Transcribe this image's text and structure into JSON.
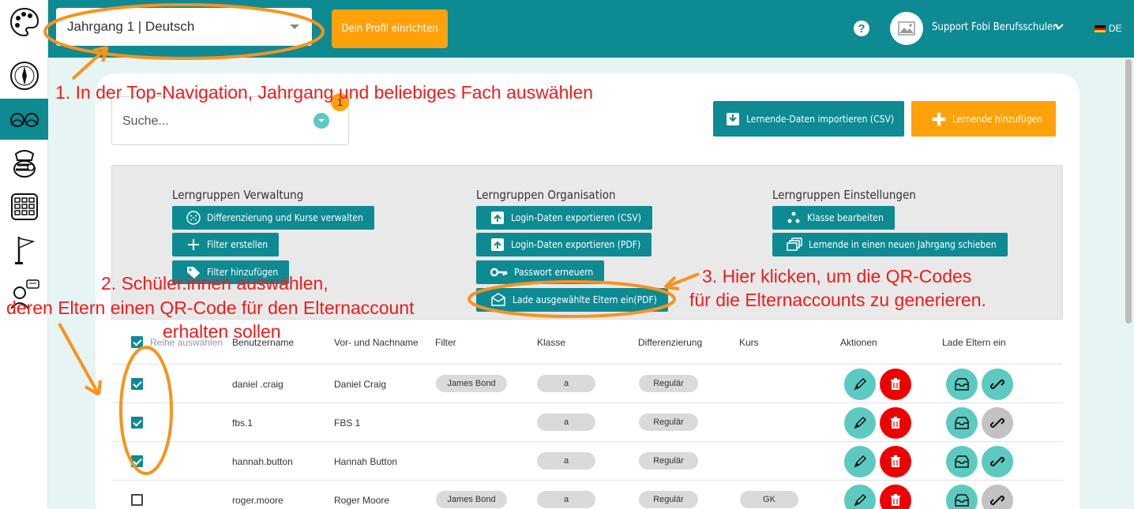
{
  "topbar": {
    "year_subject": "Jahrgang 1 | Deutsch",
    "profile_button": "Dein Profil einrichten",
    "help": "?",
    "user_name": "Support Fobi Berufsschulen",
    "language": "DE"
  },
  "sidebar": {
    "items": [
      {
        "icon": "palette-icon"
      },
      {
        "icon": "compass-icon"
      },
      {
        "icon": "students-icon",
        "active": true
      },
      {
        "icon": "chef-bee-icon"
      },
      {
        "icon": "calendar-grid-icon"
      },
      {
        "icon": "flag-icon"
      },
      {
        "icon": "speech-person-icon"
      }
    ]
  },
  "search": {
    "placeholder": "Suche...",
    "badge": "1"
  },
  "actions": {
    "import_csv": "Lernende-Daten importieren (CSV)",
    "add_learner": "Lernende hinzufügen"
  },
  "panel": {
    "verwaltung": {
      "title": "Lerngruppen Verwaltung",
      "buttons": [
        "Differenzierung und Kurse verwalten",
        "Filter erstellen",
        "Filter hinzufügen"
      ]
    },
    "organisation": {
      "title": "Lerngruppen Organisation",
      "buttons": [
        "Login-Daten exportieren (CSV)",
        "Login-Daten exportieren (PDF)",
        "Passwort erneuern",
        "Lade ausgewählte Eltern ein(PDF)"
      ]
    },
    "einstellungen": {
      "title": "Lerngruppen Einstellungen",
      "buttons": [
        "Klasse bearbeiten",
        "Lernende in einen neuen Jahrgang schieben"
      ]
    }
  },
  "table": {
    "headers": {
      "select_all": "Reihe auswählen",
      "username": "Benutzername",
      "fullname": "Vor- und Nachname",
      "filter": "Filter",
      "klasse": "Klasse",
      "differenzierung": "Differenzierung",
      "kurs": "Kurs",
      "aktionen": "Aktionen",
      "eltern": "Lade Eltern ein"
    },
    "rows": [
      {
        "checked": true,
        "username": "daniel .craig",
        "name": "Daniel Craig",
        "filter": "James Bond",
        "klasse": "a",
        "diff": "Regulär",
        "kurs": "",
        "linked": true
      },
      {
        "checked": true,
        "username": "fbs.1",
        "name": "FBS 1",
        "filter": "",
        "klasse": "a",
        "diff": "Regulär",
        "kurs": "",
        "linked": false
      },
      {
        "checked": true,
        "username": "hannah.button",
        "name": "Hannah Button",
        "filter": "",
        "klasse": "a",
        "diff": "Regulär",
        "kurs": "",
        "linked": true
      },
      {
        "checked": false,
        "username": "roger.moore",
        "name": "Roger Moore",
        "filter": "James Bond",
        "klasse": "a",
        "diff": "Regulär",
        "kurs": "GK",
        "linked": false
      }
    ]
  },
  "annotations": {
    "step1": "1. In der Top-Navigation, Jahrgang und beliebiges Fach auswählen",
    "step2_line1": "2. Schüler.innen auswählen,",
    "step2_line2": "deren Eltern einen QR-Code für den Elternaccount",
    "step2_line3": "erhalten sollen",
    "step3_line1": "3. Hier klicken, um die QR-Codes",
    "step3_line2": "für die Elternaccounts zu generieren.",
    "color": "#ee1c1c",
    "highlight_color": "#f7931e"
  },
  "colors": {
    "teal": "#0e8a93",
    "orange": "#ffa10a",
    "mint": "#5ccac1",
    "red": "#ee0000"
  }
}
